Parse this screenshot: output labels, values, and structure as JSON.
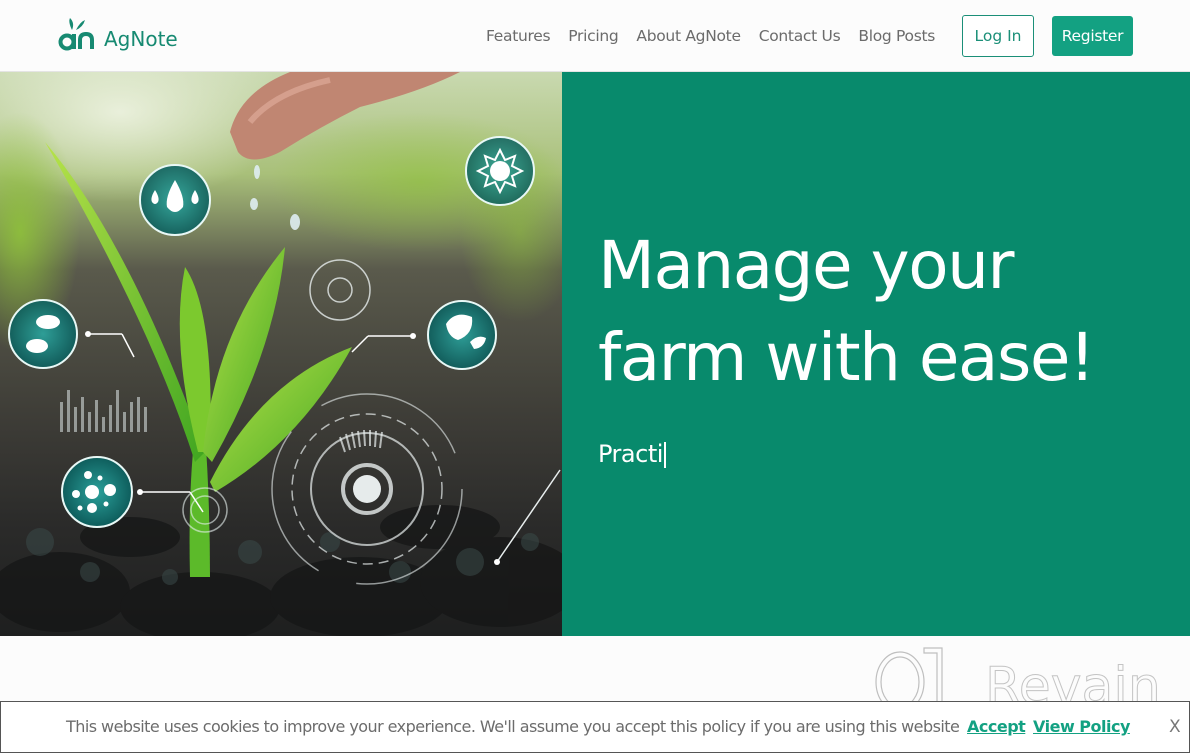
{
  "brand": {
    "name": "AgNote",
    "logo_mark": "an-leaf-logo",
    "accent_color": "#13a182",
    "panel_color": "#088a6c"
  },
  "nav": {
    "links": [
      {
        "label": "Features"
      },
      {
        "label": "Pricing"
      },
      {
        "label": "About AgNote"
      },
      {
        "label": "Contact Us"
      },
      {
        "label": "Blog Posts"
      }
    ],
    "login_label": "Log In",
    "register_label": "Register"
  },
  "hero": {
    "title_line1": "Manage your",
    "title_line2": "farm with ease!",
    "typed_subtitle": "Practi",
    "image_description": "seedling-with-smart-farming-icons",
    "image_icons": [
      "water-drops-icon",
      "sun-icon",
      "pest-icon",
      "leaf-icon",
      "molecule-icon",
      "target-gauge-icon",
      "bar-graph-icon"
    ]
  },
  "cookie_banner": {
    "message": "This website uses cookies to improve your experience. We'll assume you accept this policy if you are using this website",
    "accept_label": "Accept",
    "policy_label": "View Policy",
    "close_label": "X"
  },
  "watermark": {
    "text": "Revain"
  }
}
